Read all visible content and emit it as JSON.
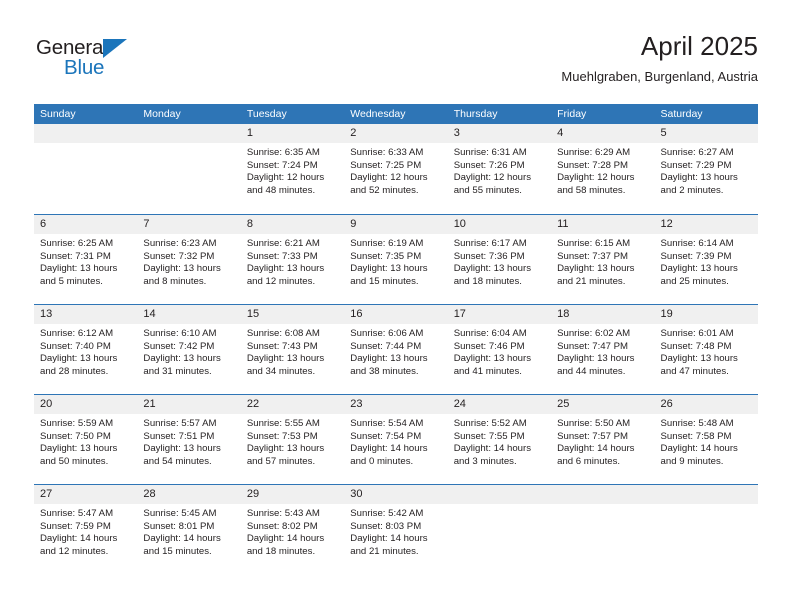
{
  "brand": {
    "name_top": "General",
    "name_bottom": "Blue",
    "triangle_color": "#1b75bb",
    "text_color": "#231f20"
  },
  "header": {
    "title": "April 2025",
    "subtitle": "Muehlgraben, Burgenland, Austria"
  },
  "theme": {
    "header_blue": "#2e75b6",
    "daynum_band": "#f0f0f0",
    "text": "#231f20",
    "page_background": "#ffffff"
  },
  "calendar": {
    "weekday_headers": [
      "Sunday",
      "Monday",
      "Tuesday",
      "Wednesday",
      "Thursday",
      "Friday",
      "Saturday"
    ],
    "weeks": [
      [
        {
          "day": "",
          "empty": true
        },
        {
          "day": "",
          "empty": true
        },
        {
          "day": "1",
          "sunrise": "Sunrise: 6:35 AM",
          "sunset": "Sunset: 7:24 PM",
          "daylight1": "Daylight: 12 hours",
          "daylight2": "and 48 minutes."
        },
        {
          "day": "2",
          "sunrise": "Sunrise: 6:33 AM",
          "sunset": "Sunset: 7:25 PM",
          "daylight1": "Daylight: 12 hours",
          "daylight2": "and 52 minutes."
        },
        {
          "day": "3",
          "sunrise": "Sunrise: 6:31 AM",
          "sunset": "Sunset: 7:26 PM",
          "daylight1": "Daylight: 12 hours",
          "daylight2": "and 55 minutes."
        },
        {
          "day": "4",
          "sunrise": "Sunrise: 6:29 AM",
          "sunset": "Sunset: 7:28 PM",
          "daylight1": "Daylight: 12 hours",
          "daylight2": "and 58 minutes."
        },
        {
          "day": "5",
          "sunrise": "Sunrise: 6:27 AM",
          "sunset": "Sunset: 7:29 PM",
          "daylight1": "Daylight: 13 hours",
          "daylight2": "and 2 minutes."
        }
      ],
      [
        {
          "day": "6",
          "sunrise": "Sunrise: 6:25 AM",
          "sunset": "Sunset: 7:31 PM",
          "daylight1": "Daylight: 13 hours",
          "daylight2": "and 5 minutes."
        },
        {
          "day": "7",
          "sunrise": "Sunrise: 6:23 AM",
          "sunset": "Sunset: 7:32 PM",
          "daylight1": "Daylight: 13 hours",
          "daylight2": "and 8 minutes."
        },
        {
          "day": "8",
          "sunrise": "Sunrise: 6:21 AM",
          "sunset": "Sunset: 7:33 PM",
          "daylight1": "Daylight: 13 hours",
          "daylight2": "and 12 minutes."
        },
        {
          "day": "9",
          "sunrise": "Sunrise: 6:19 AM",
          "sunset": "Sunset: 7:35 PM",
          "daylight1": "Daylight: 13 hours",
          "daylight2": "and 15 minutes."
        },
        {
          "day": "10",
          "sunrise": "Sunrise: 6:17 AM",
          "sunset": "Sunset: 7:36 PM",
          "daylight1": "Daylight: 13 hours",
          "daylight2": "and 18 minutes."
        },
        {
          "day": "11",
          "sunrise": "Sunrise: 6:15 AM",
          "sunset": "Sunset: 7:37 PM",
          "daylight1": "Daylight: 13 hours",
          "daylight2": "and 21 minutes."
        },
        {
          "day": "12",
          "sunrise": "Sunrise: 6:14 AM",
          "sunset": "Sunset: 7:39 PM",
          "daylight1": "Daylight: 13 hours",
          "daylight2": "and 25 minutes."
        }
      ],
      [
        {
          "day": "13",
          "sunrise": "Sunrise: 6:12 AM",
          "sunset": "Sunset: 7:40 PM",
          "daylight1": "Daylight: 13 hours",
          "daylight2": "and 28 minutes."
        },
        {
          "day": "14",
          "sunrise": "Sunrise: 6:10 AM",
          "sunset": "Sunset: 7:42 PM",
          "daylight1": "Daylight: 13 hours",
          "daylight2": "and 31 minutes."
        },
        {
          "day": "15",
          "sunrise": "Sunrise: 6:08 AM",
          "sunset": "Sunset: 7:43 PM",
          "daylight1": "Daylight: 13 hours",
          "daylight2": "and 34 minutes."
        },
        {
          "day": "16",
          "sunrise": "Sunrise: 6:06 AM",
          "sunset": "Sunset: 7:44 PM",
          "daylight1": "Daylight: 13 hours",
          "daylight2": "and 38 minutes."
        },
        {
          "day": "17",
          "sunrise": "Sunrise: 6:04 AM",
          "sunset": "Sunset: 7:46 PM",
          "daylight1": "Daylight: 13 hours",
          "daylight2": "and 41 minutes."
        },
        {
          "day": "18",
          "sunrise": "Sunrise: 6:02 AM",
          "sunset": "Sunset: 7:47 PM",
          "daylight1": "Daylight: 13 hours",
          "daylight2": "and 44 minutes."
        },
        {
          "day": "19",
          "sunrise": "Sunrise: 6:01 AM",
          "sunset": "Sunset: 7:48 PM",
          "daylight1": "Daylight: 13 hours",
          "daylight2": "and 47 minutes."
        }
      ],
      [
        {
          "day": "20",
          "sunrise": "Sunrise: 5:59 AM",
          "sunset": "Sunset: 7:50 PM",
          "daylight1": "Daylight: 13 hours",
          "daylight2": "and 50 minutes."
        },
        {
          "day": "21",
          "sunrise": "Sunrise: 5:57 AM",
          "sunset": "Sunset: 7:51 PM",
          "daylight1": "Daylight: 13 hours",
          "daylight2": "and 54 minutes."
        },
        {
          "day": "22",
          "sunrise": "Sunrise: 5:55 AM",
          "sunset": "Sunset: 7:53 PM",
          "daylight1": "Daylight: 13 hours",
          "daylight2": "and 57 minutes."
        },
        {
          "day": "23",
          "sunrise": "Sunrise: 5:54 AM",
          "sunset": "Sunset: 7:54 PM",
          "daylight1": "Daylight: 14 hours",
          "daylight2": "and 0 minutes."
        },
        {
          "day": "24",
          "sunrise": "Sunrise: 5:52 AM",
          "sunset": "Sunset: 7:55 PM",
          "daylight1": "Daylight: 14 hours",
          "daylight2": "and 3 minutes."
        },
        {
          "day": "25",
          "sunrise": "Sunrise: 5:50 AM",
          "sunset": "Sunset: 7:57 PM",
          "daylight1": "Daylight: 14 hours",
          "daylight2": "and 6 minutes."
        },
        {
          "day": "26",
          "sunrise": "Sunrise: 5:48 AM",
          "sunset": "Sunset: 7:58 PM",
          "daylight1": "Daylight: 14 hours",
          "daylight2": "and 9 minutes."
        }
      ],
      [
        {
          "day": "27",
          "sunrise": "Sunrise: 5:47 AM",
          "sunset": "Sunset: 7:59 PM",
          "daylight1": "Daylight: 14 hours",
          "daylight2": "and 12 minutes."
        },
        {
          "day": "28",
          "sunrise": "Sunrise: 5:45 AM",
          "sunset": "Sunset: 8:01 PM",
          "daylight1": "Daylight: 14 hours",
          "daylight2": "and 15 minutes."
        },
        {
          "day": "29",
          "sunrise": "Sunrise: 5:43 AM",
          "sunset": "Sunset: 8:02 PM",
          "daylight1": "Daylight: 14 hours",
          "daylight2": "and 18 minutes."
        },
        {
          "day": "30",
          "sunrise": "Sunrise: 5:42 AM",
          "sunset": "Sunset: 8:03 PM",
          "daylight1": "Daylight: 14 hours",
          "daylight2": "and 21 minutes."
        },
        {
          "day": "",
          "empty": true
        },
        {
          "day": "",
          "empty": true
        },
        {
          "day": "",
          "empty": true
        }
      ]
    ]
  }
}
